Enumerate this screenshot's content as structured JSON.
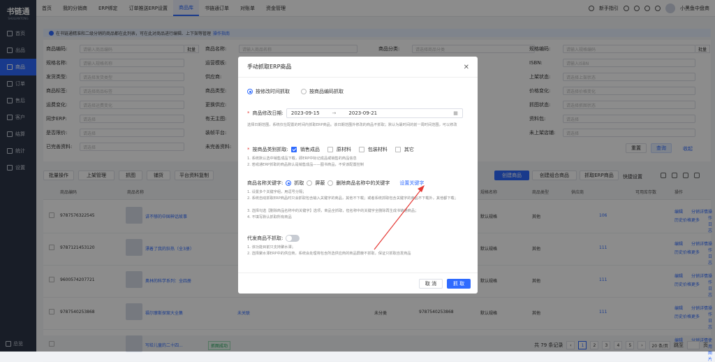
{
  "app": {
    "logo": "书链通",
    "logo_sub": "SHULIANTONG"
  },
  "sidebar": {
    "items": [
      {
        "label": "首页"
      },
      {
        "label": "出品"
      },
      {
        "label": "商品"
      },
      {
        "label": "订单"
      },
      {
        "label": "售后"
      },
      {
        "label": "客户"
      },
      {
        "label": "结算"
      },
      {
        "label": "统计"
      },
      {
        "label": "设置"
      }
    ],
    "active_index": 2,
    "bottom": "总览"
  },
  "topnav": {
    "tabs": [
      "首页",
      "我的分销商",
      "ERP绑定",
      "订单推送ERP设置",
      "商品库",
      "书链通订单",
      "对账单",
      "资金管理"
    ],
    "active_index": 4,
    "guide": "新手指引",
    "user": "小黑鱼中盘商"
  },
  "notice": {
    "text": "在书链通精准和二级分销的商品都在此列表，可在此对商品进行编辑、上下架等管理",
    "link": "操作指南"
  },
  "filters": {
    "row1": [
      {
        "label": "商品编码:",
        "placeholder": "请输入商品编码",
        "btn": "批量"
      },
      {
        "label": "商品名称:",
        "placeholder": "请输入商品名称"
      },
      {
        "label": "商品分类:",
        "placeholder": "请选择商品分类"
      },
      {
        "label": "规格编码:",
        "placeholder": "请输入规格编码",
        "btn": "批量"
      }
    ],
    "row2": [
      {
        "label": "规格名称:",
        "placeholder": "请输入规格名称"
      },
      {
        "label": "运营模板:"
      },
      {
        "label": "ISBN:",
        "placeholder": "请输入ISBN"
      }
    ],
    "row3": [
      {
        "label": "发货类型:",
        "placeholder": "请选择发货类型"
      },
      {
        "label": "供应商:"
      },
      {
        "label": "上架状态:",
        "placeholder": "请选择上架状态"
      }
    ],
    "row4": [
      {
        "label": "商品标签:",
        "placeholder": "请选择商品标签"
      },
      {
        "label": "商品类型:"
      },
      {
        "label": "价格变化:",
        "placeholder": "请选择价格变化"
      }
    ],
    "row5": [
      {
        "label": "运费变化:",
        "placeholder": "请选择运费变化"
      },
      {
        "label": "更换供应:"
      },
      {
        "label": "抓图状态:",
        "placeholder": "请选择抓图状态"
      }
    ],
    "row6": [
      {
        "label": "同步ERP:",
        "placeholder": "请选择"
      },
      {
        "label": "有无主图:"
      },
      {
        "label": "资料包:",
        "placeholder": "请选择"
      }
    ],
    "row7": [
      {
        "label": "是否限价:",
        "placeholder": "请选择"
      },
      {
        "label": "装帧平台:"
      },
      {
        "label": "未上架店铺:",
        "placeholder": "请选择"
      }
    ],
    "row8": [
      {
        "label": "已完善资料:",
        "placeholder": "请选择"
      },
      {
        "label": "未完善资料:"
      }
    ],
    "reset": "重置",
    "search": "查询",
    "collapse": "收起"
  },
  "toolbar": {
    "left": [
      "批量操作",
      "上架管理",
      "抓图",
      "铺货",
      "平台资料复制"
    ],
    "create": "创建商品",
    "create_combo": "创建组合商品",
    "fetch_erp": "抓取ERP商品",
    "quick": "快捷设置"
  },
  "table": {
    "headers": [
      "商品编码",
      "商品名称",
      "规格名称",
      "商品类型",
      "供应商",
      "可用库存数",
      "操作"
    ],
    "rows": [
      {
        "code": "9787576322545",
        "name": "讲不够的中国神话故事",
        "spec": "默认规格",
        "type": "其他",
        "stock": "106",
        "actions": [
          "编辑",
          "分销详情",
          "操作日志",
          "历史价格",
          "更多"
        ]
      },
      {
        "code": "9787121453120",
        "name": "漂着了我的狂热（全3册）",
        "spec": "默认规格",
        "type": "其他",
        "stock": "111",
        "actions": [
          "编辑",
          "分销详情",
          "操作日志",
          "历史价格",
          "更多"
        ]
      },
      {
        "code": "9600574207721",
        "name": "奥林的科学系列：全四册",
        "spec": "默认规格",
        "type": "其他",
        "stock": "111",
        "actions": [
          "编辑",
          "分销详情",
          "操作日志",
          "历史价格",
          "更多"
        ]
      },
      {
        "code": "9787540253868",
        "name": "福尔摩斯探案大全集",
        "spec": "默认规格",
        "type": "其他",
        "stock": "111",
        "extra": "未关联",
        "cat": "未分类",
        "isbn": "9787540253868",
        "actions": [
          "编辑",
          "分销详情",
          "操作日志",
          "历史价格",
          "更多"
        ]
      },
      {
        "code": "",
        "name": "写给儿童的二十四...",
        "tag": "抓图成功",
        "actions": [
          "编辑",
          "分销详情",
          "使用图片"
        ]
      }
    ]
  },
  "pager": {
    "total": "共 79 条记录",
    "pages": [
      "1",
      "2",
      "3",
      "4",
      "5"
    ],
    "active": "1",
    "size": "20 条/页",
    "goto": "跳至",
    "unit": "页"
  },
  "modal": {
    "title": "手动抓取ERP商品",
    "modes": [
      "按修改时间抓取",
      "按商品编码抓取"
    ],
    "date_label": "商品修改日期:",
    "date_start": "2023-09-15",
    "date_sep": "→",
    "date_end": "2023-09-21",
    "date_hint": "选择日期范围，系统仅在配置的时间内抓取ERP商品。该日期范围外修改的商品不抓取；默认为最时间的前一周时间范围，可以修改",
    "cat_label": "按商品类别抓取:",
    "cats": [
      {
        "label": "销售成品",
        "on": true
      },
      {
        "label": "原材料",
        "on": false
      },
      {
        "label": "包装材料",
        "on": false
      },
      {
        "label": "其它",
        "on": false
      }
    ],
    "cat_hint1": "1. 系统默认选中销售成品下载，即ERP中标记成品或销售的商品信息",
    "cat_hint2": "2. 若戒通ERP抓取的商品默认是销售成品——图书商品，不受该配置控制",
    "kw_label": "商品名称关键字:",
    "kw_opts": [
      "抓取",
      "屏蔽",
      "删除商品名称中的关键字"
    ],
    "kw_link": "设置关键字",
    "kw_hints": [
      "1. 设置多个关键字组，用逗号分隔；",
      "2. 系统自动抓取ERP商品时只会抓取包含输入关键字的商品，其他不下载；或者系统抓取包含关键字的商品不下载外，其他都下载；",
      "3. 选择勾选【删除商品名称中的关键字】选项，商品全抓取，但名称中的关键字全删除再生成书链通商品；",
      "4. 不填写默认抓取所有商品"
    ],
    "proxy_label": "代发商品不抓取:",
    "proxy_hints": [
      "1. 该功能目前只支持聚水潭；",
      "2. 选择聚水潭ERP中的供应商，系统会处理将包含所选供应商的商品屏蔽不抓取，保证只抓取自发商品"
    ],
    "cancel": "取 消",
    "ok": "抓 取"
  },
  "colors": {
    "primary": "#2f6bff",
    "sidebar": "#2c3548",
    "annotation": "#e53935"
  }
}
